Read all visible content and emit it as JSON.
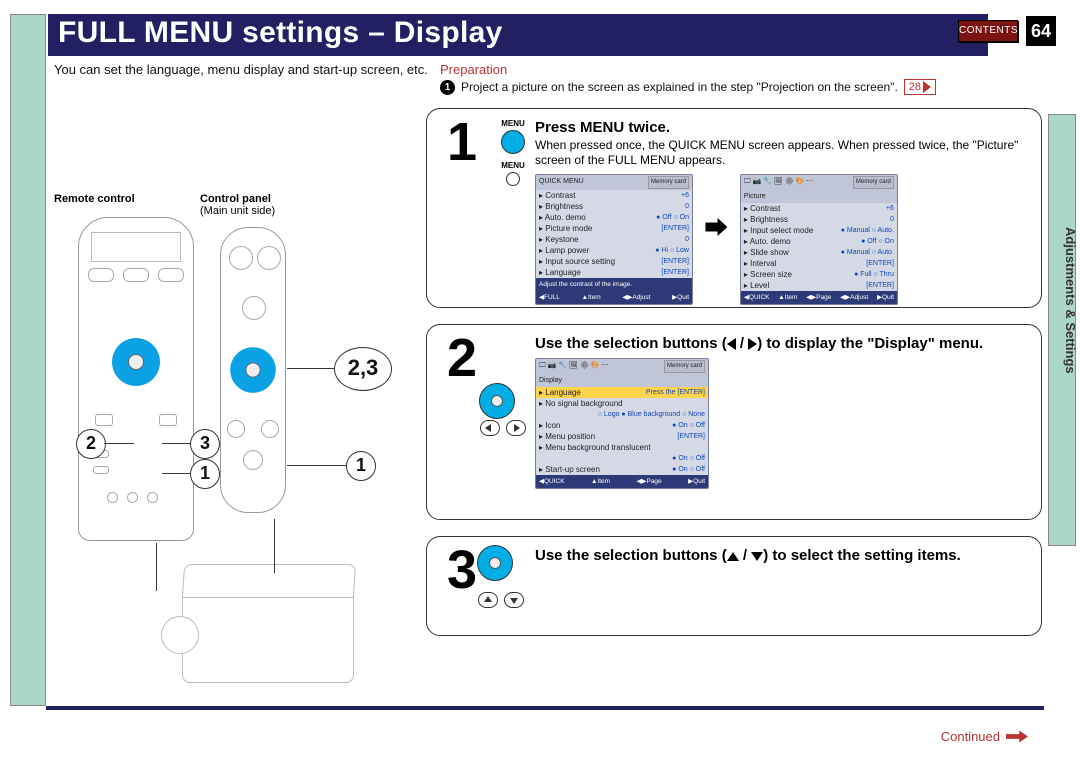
{
  "page": {
    "number": "64",
    "section": "Adjustments & Settings",
    "contents_label": "CONTENTS",
    "continued": "Continued"
  },
  "title": "FULL MENU settings – Display",
  "intro": "You can set the language, menu display and start-up screen, etc.",
  "labels": {
    "remote": "Remote control",
    "panel": "Control panel",
    "panel_sub": "(Main unit side)"
  },
  "prep": {
    "heading": "Preparation",
    "step_no": "1",
    "text": "Project a picture on the screen as explained in the step \"Projection on the screen\".",
    "link": "28"
  },
  "callouts": {
    "c23": "2,3",
    "c1r": "1",
    "c2l": "2",
    "c3l": "3",
    "c1l": "1"
  },
  "step1": {
    "num": "1",
    "menu_cap": "MENU",
    "title": "Press MENU twice.",
    "body": "When pressed once, the QUICK MENU screen appears. When pressed twice, the \"Picture\" screen of the FULL MENU appears."
  },
  "step2": {
    "num": "2",
    "title": "Use the selection buttons (◀ / ▶) to display the \"Display\" menu."
  },
  "step3": {
    "num": "3",
    "title": "Use the selection buttons (▲ / ▼) to select the setting items."
  },
  "osd_quick": {
    "header": "QUICK MENU",
    "tab": "Memory card",
    "rows": [
      {
        "lab": "Contrast",
        "val": "+6"
      },
      {
        "lab": "Brightness",
        "val": "0"
      },
      {
        "lab": "Auto. demo",
        "val": "● Off   ○ On"
      },
      {
        "lab": "Picture mode",
        "val": "[ENTER]"
      },
      {
        "lab": "Keystone",
        "val": "0"
      },
      {
        "lab": "Lamp power",
        "val": "● Hi   ○ Low"
      },
      {
        "lab": "Input source setting",
        "val": "[ENTER]"
      },
      {
        "lab": "Language",
        "val": "[ENTER]"
      }
    ],
    "hint": "Adjust the contrast of the image.",
    "foot": [
      "◀FULL",
      "▲Item",
      "◀▶Adjust",
      "▶Quit"
    ]
  },
  "osd_picture": {
    "header": "Picture",
    "tab": "Memory card",
    "rows": [
      {
        "lab": "Contrast",
        "val": "+6"
      },
      {
        "lab": "Brightness",
        "val": "0"
      },
      {
        "lab": "Input select mode",
        "val": "● Manual  ○ Auto."
      },
      {
        "lab": "Auto. demo",
        "val": "● Off  ○ On"
      },
      {
        "lab": "Slide show",
        "val": "● Manual  ○ Auto."
      },
      {
        "lab": "Interval",
        "val": "[ENTER]"
      },
      {
        "lab": "Screen size",
        "val": "● Full  ○ Thru"
      },
      {
        "lab": "Level",
        "val": "[ENTER]"
      }
    ],
    "foot": [
      "◀QUICK",
      "▲Item",
      "◀▶Page",
      "◀▶Adjust",
      "▶Quit"
    ]
  },
  "osd_display": {
    "header": "Display",
    "tab": "Memory card",
    "rows": [
      {
        "lab": "Language",
        "val": "Press the [ENTER]",
        "sel": true
      },
      {
        "lab": "No signal background",
        "val": ""
      },
      {
        "lab": "",
        "val": "○ Logo  ● Blue background  ○ None"
      },
      {
        "lab": "Icon",
        "val": "● On   ○ Off"
      },
      {
        "lab": "Menu position",
        "val": "[ENTER]"
      },
      {
        "lab": "Menu background translucent",
        "val": ""
      },
      {
        "lab": "",
        "val": "● On   ○ Off"
      },
      {
        "lab": "Start-up screen",
        "val": "● On   ○ Off"
      }
    ],
    "foot": [
      "◀QUICK",
      "▲Item",
      "◀▶Page",
      "▶Quit"
    ]
  }
}
